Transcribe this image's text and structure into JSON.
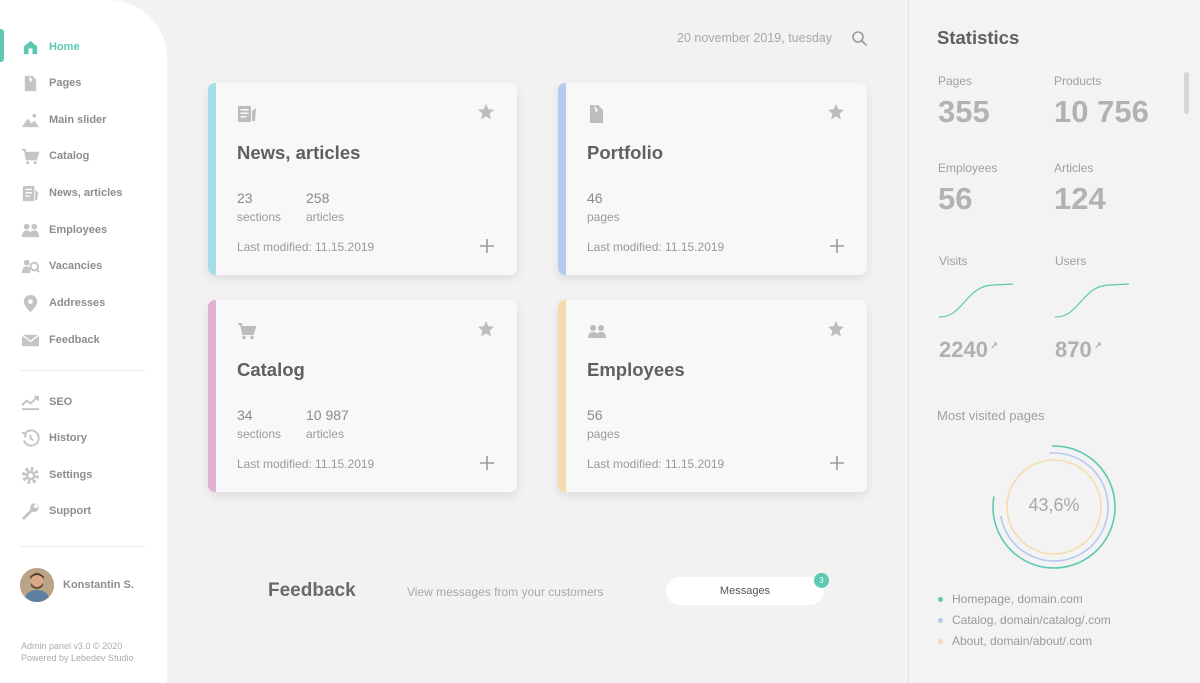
{
  "sidebar": {
    "items": [
      {
        "label": "Home",
        "icon": "home-icon"
      },
      {
        "label": "Pages",
        "icon": "pages-icon"
      },
      {
        "label": "Main slider",
        "icon": "image-icon"
      },
      {
        "label": "Catalog",
        "icon": "cart-icon"
      },
      {
        "label": "News, articles",
        "icon": "news-icon"
      },
      {
        "label": "Employees",
        "icon": "people-icon"
      },
      {
        "label": "Vacancies",
        "icon": "vacancies-icon"
      },
      {
        "label": "Addresses",
        "icon": "location-pin-icon"
      },
      {
        "label": "Feedback",
        "icon": "envelope-icon"
      },
      {
        "label": "SEO",
        "icon": "chart-line-icon"
      },
      {
        "label": "History",
        "icon": "history-icon"
      },
      {
        "label": "Settings",
        "icon": "gear-icon"
      },
      {
        "label": "Support",
        "icon": "wrench-icon"
      }
    ],
    "active": "Home",
    "user": {
      "name": "Konstantin S."
    },
    "footer_line1": "Admin panel v3.0 © 2020",
    "footer_line2": "Powered by Lebedev Studio"
  },
  "header": {
    "date": "20 november 2019, tuesday"
  },
  "cards": [
    {
      "title": "News, articles",
      "accent": "#a6dde8",
      "icon": "news-icon",
      "stats": [
        {
          "num": "23",
          "label": "sections"
        },
        {
          "num": "258",
          "label": "articles"
        }
      ],
      "modified": "Last modified: 11.15.2019"
    },
    {
      "title": "Portfolio",
      "accent": "#b8c8f0",
      "icon": "pages-icon",
      "stats": [
        {
          "num": "46",
          "label": "pages"
        }
      ],
      "modified": "Last modified: 11.15.2019"
    },
    {
      "title": "Catalog",
      "accent": "#e2b1d2",
      "icon": "cart-icon",
      "stats": [
        {
          "num": "34",
          "label": "sections"
        },
        {
          "num": "10 987",
          "label": "articles"
        }
      ],
      "modified": "Last modified: 11.15.2019"
    },
    {
      "title": "Employees",
      "accent": "#f5dcb0",
      "icon": "people-icon",
      "stats": [
        {
          "num": "56",
          "label": "pages"
        }
      ],
      "modified": "Last modified: 11.15.2019"
    }
  ],
  "feedback": {
    "title": "Feedback",
    "subtitle": "View messages from your customers",
    "button": "Messages",
    "badge": "3"
  },
  "statistics": {
    "title": "Statistics",
    "pages_label": "Pages",
    "pages": "355",
    "products_label": "Products",
    "products": "10 756",
    "employees_label": "Employees",
    "employees": "56",
    "articles_label": "Articles",
    "articles": "124",
    "visits_label": "Visits",
    "visits": "2240",
    "users_label": "Users",
    "users": "870",
    "trend_arrow": "↗",
    "accent": "#5cc9b0",
    "most_visited_title": "Most visited pages",
    "percent": "43,6%",
    "legend": [
      {
        "label": "Homepage, domain.com",
        "color": "#5cc9b0"
      },
      {
        "label": "Catalog, domain/catalog/.com",
        "color": "#b8c8f0"
      },
      {
        "label": "About, domain/about/.com",
        "color": "#f5dcb0"
      }
    ]
  }
}
